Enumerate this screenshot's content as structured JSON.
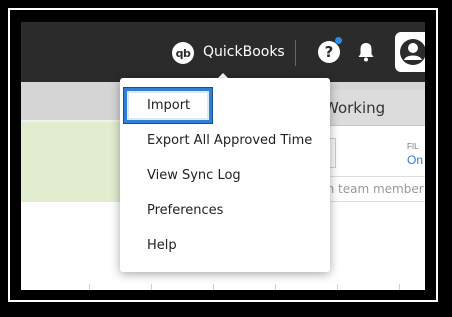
{
  "topbar": {
    "logo_text": "qb",
    "integration_label": "QuickBooks",
    "help_label": "?",
    "notification_dot_color": "#2d8ce8"
  },
  "panel": {
    "title": "Working",
    "filter_label": "FIL",
    "filter_value": "On",
    "search_placeholder": "ch team member"
  },
  "menu": {
    "items": [
      {
        "label": "Import",
        "highlighted": true
      },
      {
        "label": "Export All Approved Time"
      },
      {
        "label": "View Sync Log"
      },
      {
        "label": "Preferences"
      },
      {
        "label": "Help"
      }
    ],
    "highlight_color": "#2f7fd6"
  }
}
